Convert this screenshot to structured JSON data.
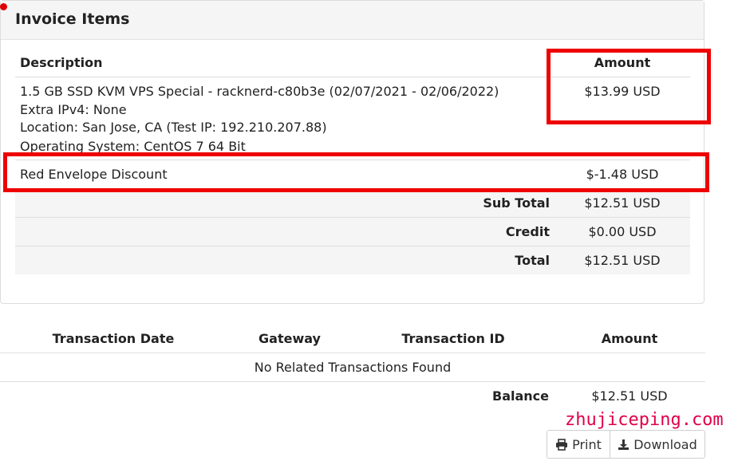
{
  "panel": {
    "title": "Invoice Items"
  },
  "items_table": {
    "col_description": "Description",
    "col_amount": "Amount",
    "item": {
      "line1": "1.5 GB SSD KVM VPS Special - racknerd-c80b3e (02/07/2021 - 02/06/2022)",
      "line2": "Extra IPv4: None",
      "line3": "Location: San Jose, CA (Test IP: 192.210.207.88)",
      "line4": "Operating System: CentOS 7 64 Bit",
      "amount": "$13.99 USD"
    },
    "discount": {
      "description": "Red Envelope Discount",
      "amount": "$-1.48 USD"
    },
    "subtotal": {
      "label": "Sub Total",
      "value": "$12.51 USD"
    },
    "credit": {
      "label": "Credit",
      "value": "$0.00 USD"
    },
    "total": {
      "label": "Total",
      "value": "$12.51 USD"
    }
  },
  "transactions": {
    "col_date": "Transaction Date",
    "col_gateway": "Gateway",
    "col_id": "Transaction ID",
    "col_amount": "Amount",
    "empty_message": "No Related Transactions Found",
    "balance_label": "Balance",
    "balance_value": "$12.51 USD"
  },
  "watermark": "zhujiceping.com",
  "buttons": {
    "print": "Print",
    "download": "Download"
  },
  "colors": {
    "highlight": "#ee0000",
    "watermark": "#e0004a"
  },
  "icons": {
    "print": "printer-icon",
    "download": "download-icon"
  }
}
